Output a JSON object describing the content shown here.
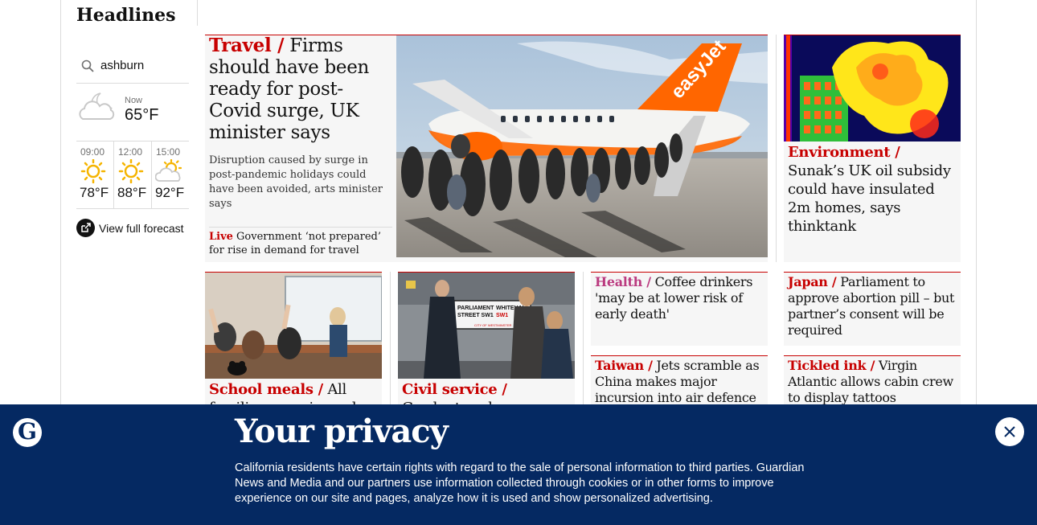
{
  "section": {
    "title": "Headlines"
  },
  "weather": {
    "location_value": "ashburn",
    "now": {
      "label": "Now",
      "temp": "65°F",
      "icon": "cloudy-night-icon"
    },
    "forecast": [
      {
        "time": "09:00",
        "temp": "78°F",
        "icon": "sun-icon"
      },
      {
        "time": "12:00",
        "temp": "88°F",
        "icon": "sun-icon"
      },
      {
        "time": "15:00",
        "temp": "92°F",
        "icon": "partly-cloudy-icon"
      }
    ],
    "full_forecast_label": "View full forecast"
  },
  "main_story": {
    "kicker": "Travel /",
    "headline": " Firms should have been ready for post-Covid surge, UK minister says",
    "standfirst": "Disruption caused by surge in post-pandemic holidays could have been avoided, arts minister says",
    "live_label": "Live",
    "live_text": " Government ‘not prepared’ for rise in demand for travel",
    "plane_text": "easyJet"
  },
  "right_story": {
    "kicker": "Environment /",
    "headline": " Sunak’s UK oil subsidy could have insulated 2m homes, says thinktank"
  },
  "bottom_stories": [
    {
      "kicker": "School meals /",
      "headline": " All families on universal"
    },
    {
      "kicker": "Civil service /",
      "headline": " Graduate scheme"
    }
  ],
  "sign_texts": {
    "line1": "PARLIAMENT",
    "line2": "STREET SW1",
    "line3": "WHITEHALL",
    "line4": "SW1",
    "line5": "CITY OF WESTMINSTER"
  },
  "small_stories": [
    {
      "kicker": "Health /",
      "headline": " Coffee drinkers 'may be at lower risk of early death'"
    },
    {
      "kicker": "Japan /",
      "headline": " Parliament to approve abortion pill – but partner’s consent will be required"
    },
    {
      "kicker": "Taiwan /",
      "headline": " Jets scramble as China makes major incursion into air defence"
    },
    {
      "kicker": "Tickled ink /",
      "headline": " Virgin Atlantic allows cabin crew to display tattoos"
    }
  ],
  "privacy": {
    "logo_letter": "G",
    "title": "Your privacy",
    "body": "California residents have certain rights with regard to the sale of personal information to third parties. Guardian News and Media and our partners use information collected through cookies or in other forms to improve experience on our site and pages, analyze how it is used and show personalized advertising."
  },
  "colors": {
    "news_red": "#c70000",
    "health_pink": "#bb3b80",
    "banner_blue": "#052962",
    "card_bg": "#f6f6f6"
  }
}
